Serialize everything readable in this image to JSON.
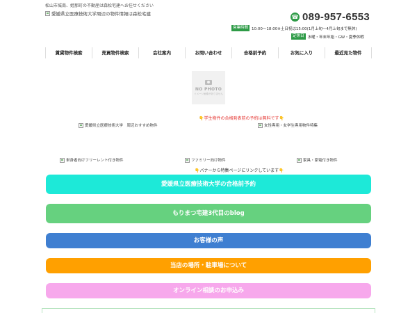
{
  "header": {
    "tagline": "松山市城南、姫那町の不動産は森松宅建へお任せください",
    "logo_alt": "愛媛県立医療技術大学周辺の物件情報は森松宅建",
    "phone": "089-957-6553",
    "hours_label": "営業時間",
    "hours_text": "10:00～18:00※土日祝は15:00(1月上旬～4月上旬まで無休)",
    "holiday_label": "定休日",
    "holiday_text": "水曜・年末年始・GW・夏季休暇"
  },
  "nav": {
    "items": [
      "賃貸物件検索",
      "売買物件検索",
      "会社案内",
      "お問い合わせ",
      "合格前予約",
      "お気に入り",
      "最近見た物件"
    ]
  },
  "placeholder": {
    "title": "NO PHOTO",
    "subtitle": "イメージ画像がありません"
  },
  "notices": {
    "student": "学生物件の合格発表前の予約は無料です",
    "banner_link": "バナーから特集ページにリンクしています"
  },
  "banners": {
    "recommended": "愛媛県立医療技術大学　周辺おすすめ物件",
    "female": "女性専用・女学生専用物件特集",
    "single_free_rent": "単身者向けフリーレント付き物件",
    "family": "ファミリー向け物件",
    "furniture": "家具・家電付き物件"
  },
  "buttons": [
    {
      "label": "愛媛県立医療技術大学の合格前予約",
      "color": "#1de9d8"
    },
    {
      "label": "もりまつ宅建3代目のblog",
      "color": "#66d17f"
    },
    {
      "label": "お客様の声",
      "color": "#3f7fd1"
    },
    {
      "label": "当店の場所・駐車場について",
      "color": "#ffa000"
    },
    {
      "label": "オンライン相談のお申込み",
      "color": "#f7a8ec"
    }
  ],
  "icons": {
    "phone": "phone-icon",
    "hand": "pointing-hand-icon",
    "camera": "camera-icon"
  }
}
